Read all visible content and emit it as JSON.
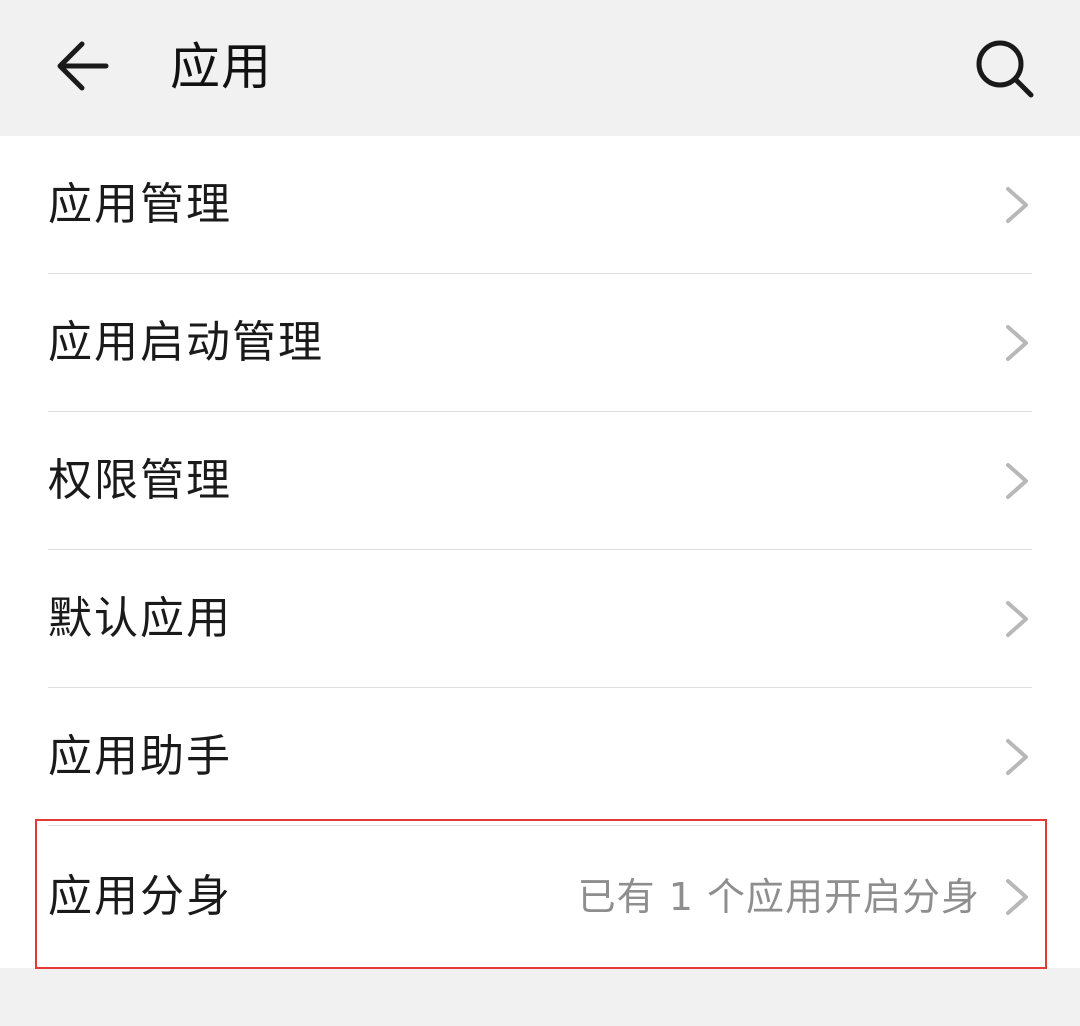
{
  "header": {
    "title": "应用",
    "back_icon": "arrow-left-icon",
    "search_icon": "search-icon"
  },
  "menu": {
    "items": [
      {
        "label": "应用管理",
        "subtitle": ""
      },
      {
        "label": "应用启动管理",
        "subtitle": ""
      },
      {
        "label": "权限管理",
        "subtitle": ""
      },
      {
        "label": "默认应用",
        "subtitle": ""
      },
      {
        "label": "应用助手",
        "subtitle": ""
      },
      {
        "label": "应用分身",
        "subtitle": "已有 1 个应用开启分身"
      }
    ]
  },
  "colors": {
    "background": "#f1f1f1",
    "list_background": "#ffffff",
    "text": "#1a1a1a",
    "secondary_text": "#8e8e8e",
    "highlight_border": "#e53935"
  }
}
